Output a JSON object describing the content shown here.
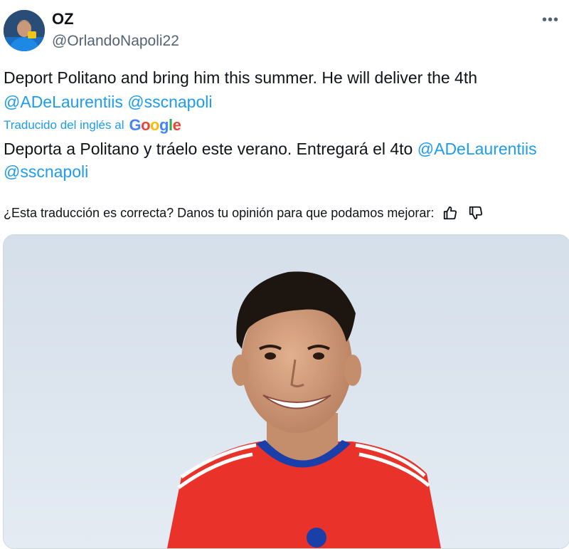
{
  "author": {
    "name": "OZ",
    "handle": "@OrlandoNapoli22"
  },
  "tweet": {
    "text": "Deport Politano and bring him this summer. He will deliver the 4th",
    "mentions": [
      "@ADeLaurentiis",
      "@sscnapoli"
    ]
  },
  "translation": {
    "label": "Traducido del inglés al",
    "provider": "Google",
    "text": "Deporta a Politano y tráelo este verano. Entregará el 4to",
    "mentions": [
      "@ADeLaurentiis",
      "@sscnapoli"
    ]
  },
  "feedback": {
    "question": "¿Esta traducción es correcta? Danos tu opinión para que podamos mejorar:"
  },
  "icons": {
    "more": "more-options-icon",
    "thumbs_up": "thumbs-up-icon",
    "thumbs_down": "thumbs-down-icon"
  },
  "colors": {
    "link": "#1d9bf0",
    "secondary_text": "#536471",
    "jersey": "#e8322a",
    "collar": "#1a3fa8"
  }
}
